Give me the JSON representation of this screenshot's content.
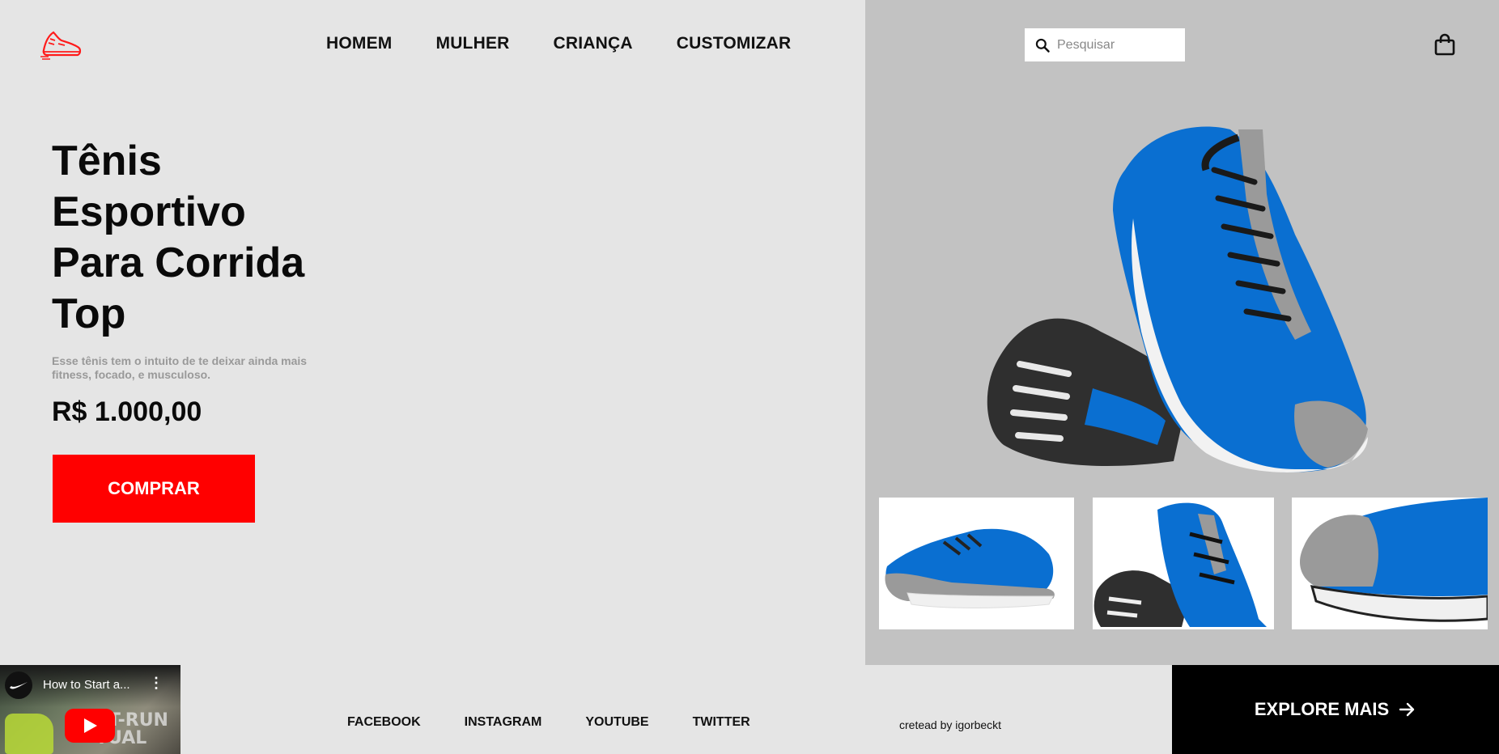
{
  "header": {
    "logo_icon": "sneaker-logo-icon",
    "nav": [
      "HOMEM",
      "MULHER",
      "CRIANÇA",
      "CUSTOMIZAR"
    ],
    "search_placeholder": "Pesquisar",
    "search_icon": "search-icon",
    "cart_icon": "shopping-bag-icon"
  },
  "hero": {
    "title": "Tênis Esportivo Para Corrida Top",
    "description": "Esse tênis tem o intuito de te deixar ainda mais fitness, focado, e musculoso.",
    "price": "R$ 1.000,00",
    "buy_label": "COMPRAR"
  },
  "colors": {
    "accent": "#ff0000",
    "left_bg": "#e5e5e5",
    "right_bg": "#c2c2c2",
    "shoe_blue": "#0a6fd1"
  },
  "video": {
    "title": "How to Start a...",
    "overlay_text": "ST-RUN TUAL",
    "menu": "⋮"
  },
  "footer": {
    "social": [
      "FACEBOOK",
      "INSTAGRAM",
      "YOUTUBE",
      "TWITTER"
    ],
    "credit": "cretead by igorbeckt",
    "explore_label": "EXPLORE MAIS"
  }
}
